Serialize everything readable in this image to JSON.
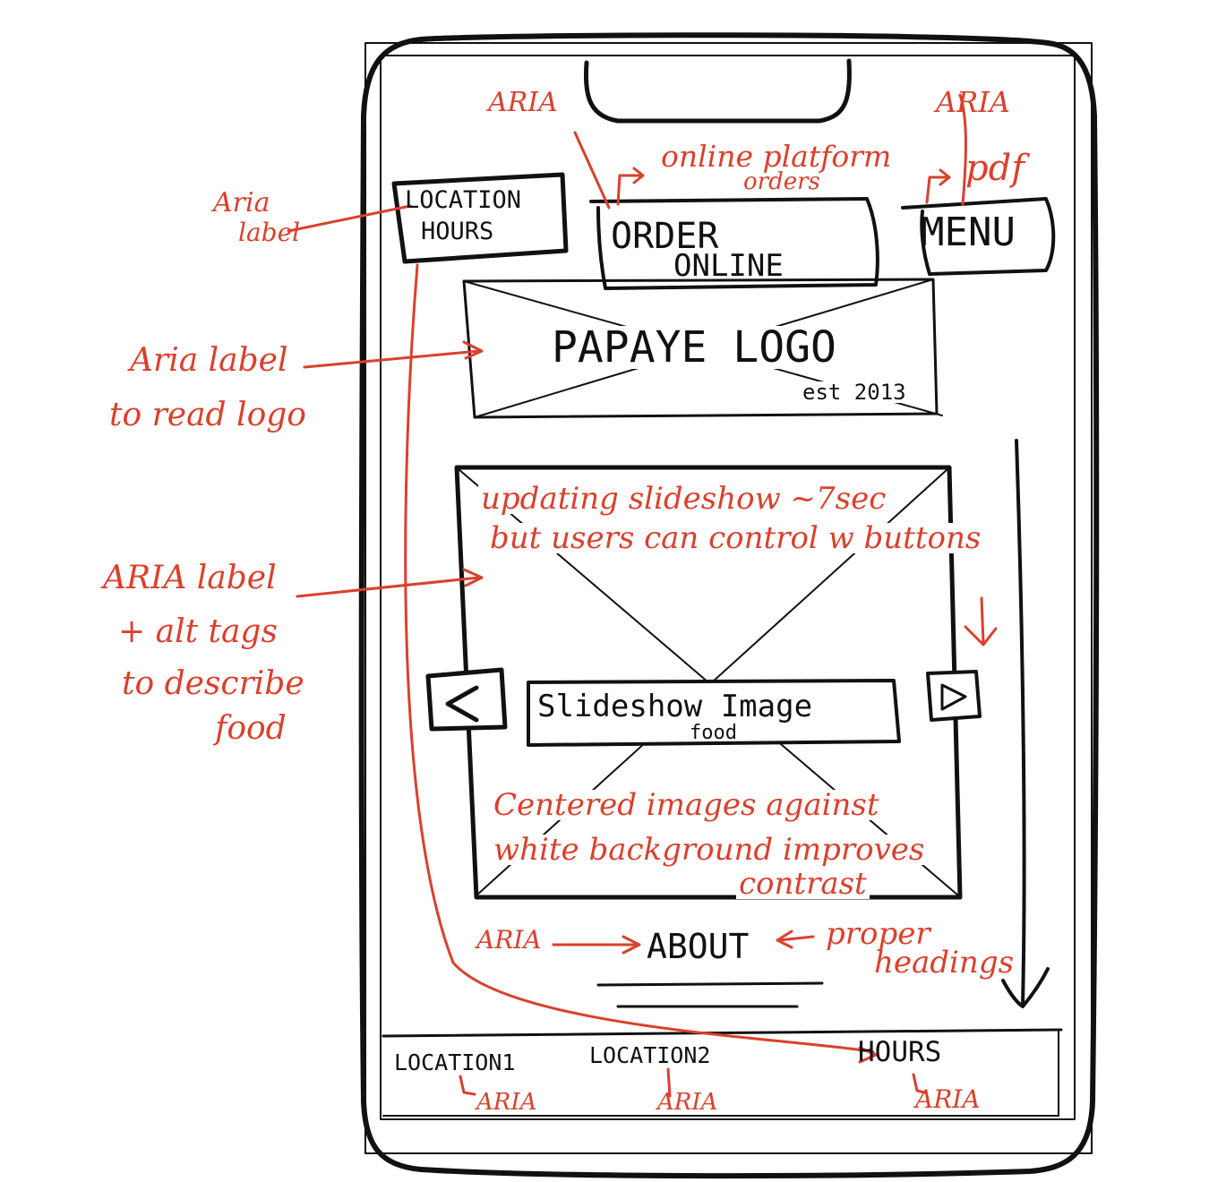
{
  "colors": {
    "ink": "#111111",
    "annotation": "#d9412d",
    "background": "#ffffff"
  },
  "wireframe": {
    "buttons": {
      "location_hours_line1": "LOCATION",
      "location_hours_line2": "HOURS",
      "order_online_line1": "ORDER",
      "order_online_line2": "ONLINE",
      "menu": "MENU"
    },
    "logo": {
      "text": "PAPAYE LOGO",
      "established": "est 2013"
    },
    "slideshow": {
      "label": "Slideshow Image",
      "sublabel": "food",
      "prev_icon": "left-arrow-icon",
      "next_icon": "right-arrow-icon"
    },
    "about_heading": "ABOUT",
    "footer": {
      "location1": "LOCATION1",
      "location2": "LOCATION2",
      "hours": "HOURS"
    }
  },
  "annotations": {
    "aria_top_left": "ARIA",
    "aria_top_right": "ARIA",
    "online_platform_line1": "online platform",
    "online_platform_line2": "orders",
    "pdf": "pdf",
    "aria_label_left_line1": "Aria",
    "aria_label_left_line2": "label",
    "aria_logo_line1": "Aria label",
    "aria_logo_line2": "to read logo",
    "aria_food_line1": "ARIA label",
    "aria_food_line2": "+ alt tags",
    "aria_food_line3": "to describe",
    "aria_food_line4": "food",
    "slideshow_note_line1": "updating slideshow ~7sec",
    "slideshow_note_line2": "but users can control w buttons",
    "contrast_line1": "Centered images against",
    "contrast_line2": "white background improves",
    "contrast_line3": "contrast",
    "aria_about": "ARIA",
    "headings_line1": "proper",
    "headings_line2": "headings",
    "aria_footer_1": "ARIA",
    "aria_footer_2": "ARIA",
    "aria_footer_3": "ARIA"
  }
}
